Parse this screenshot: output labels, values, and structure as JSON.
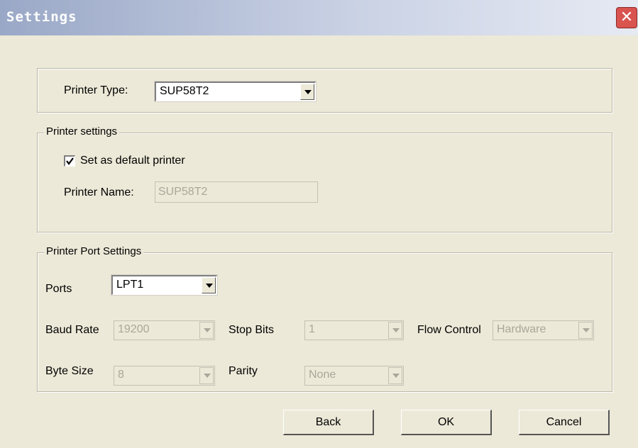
{
  "window": {
    "title": "Settings",
    "close_glyph": "✕"
  },
  "printer_type": {
    "label": "Printer Type:",
    "value": "SUP58T2"
  },
  "printer_settings": {
    "legend": "Printer settings",
    "default_checkbox": {
      "label": "Set as default printer",
      "checked": true
    },
    "name_label": "Printer Name:",
    "name_value": "SUP58T2"
  },
  "port_settings": {
    "legend": "Printer Port Settings",
    "ports_label": "Ports",
    "ports_value": "LPT1",
    "baud_label": "Baud Rate",
    "baud_value": "19200",
    "stop_label": "Stop Bits",
    "stop_value": "1",
    "flow_label": "Flow Control",
    "flow_value": "Hardware",
    "byte_label": "Byte Size",
    "byte_value": "8",
    "parity_label": "Parity",
    "parity_value": "None"
  },
  "buttons": {
    "back": "Back",
    "ok": "OK",
    "cancel": "Cancel"
  },
  "icons": [
    "close-icon",
    "dropdown-arrow-icon",
    "checkmark-icon"
  ],
  "colors": {
    "dialog_bg": "#ece9d8",
    "close_red": "#d9534f",
    "disabled_text": "#a9a79a"
  }
}
